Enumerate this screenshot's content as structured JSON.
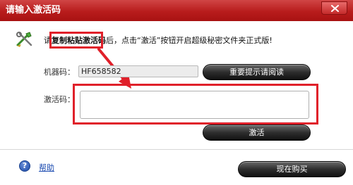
{
  "window": {
    "title": "请输入激活码",
    "close_label": "✕"
  },
  "instruction": {
    "prefix": "请",
    "highlight": "复制粘贴激活码",
    "suffix": "后，点击“激活”按钮开启超级秘密文件夹正式版!"
  },
  "machine_code": {
    "label": "机器码：",
    "value": "HF658582"
  },
  "important_button": {
    "label": "重要提示请阅读"
  },
  "activation_code": {
    "label": "激活码：",
    "value": ""
  },
  "activate_button": {
    "label": "激活"
  },
  "footer": {
    "help_icon": "?",
    "help_link": "帮助",
    "buy_button": "现在购买"
  },
  "colors": {
    "titlebar": "#b81c1c",
    "highlight_border": "#e0202a",
    "button_dark": "#2e2e2e",
    "link": "#1a4ab0"
  },
  "icons": {
    "close": "close-icon",
    "tool": "tools-icon",
    "help": "question-icon"
  }
}
